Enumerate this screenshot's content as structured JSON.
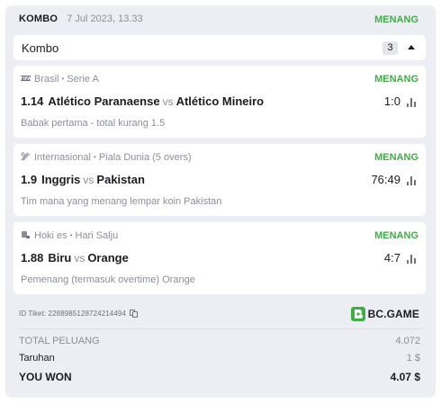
{
  "header": {
    "type": "KOMBO",
    "date": "7 Jul 2023, 13.33",
    "status": "MENANG"
  },
  "combo": {
    "label": "Kombo",
    "count": "3"
  },
  "bets": [
    {
      "league_icon": "football-icon",
      "region": "Brasil",
      "league": "Serie A",
      "status": "MENANG",
      "odds": "1.14",
      "team1": "Atlético Paranaense",
      "vs": "vs",
      "team2": "Atlético Mineiro",
      "score": "1:0",
      "market": "Babak pertama - total kurang 1.5"
    },
    {
      "league_icon": "cricket-icon",
      "region": "Internasional",
      "league": "Piala Dunia (5 overs)",
      "status": "MENANG",
      "odds": "1.9",
      "team1": "Inggris",
      "vs": "vs",
      "team2": "Pakistan",
      "score": "76:49",
      "market": "Tim mana yang menang lempar koin Pakistan"
    },
    {
      "league_icon": "hockey-icon",
      "region": "Hoki es",
      "league": "Hari Salju",
      "status": "MENANG",
      "odds": "1.88",
      "team1": "Biru",
      "vs": "vs",
      "team2": "Orange",
      "score": "4:7",
      "market": "Pemenang (termasuk overtime) Orange"
    }
  ],
  "ticket": {
    "id_label": "ID Tiket: 2288985128724214494"
  },
  "brand": {
    "name": "BC.GAME",
    "color": "#3cb043"
  },
  "summary": {
    "total_odds_label": "TOTAL PELUANG",
    "total_odds": "4.072",
    "stake_label": "Taruhan",
    "stake": "1 $",
    "won_label": "YOU WON",
    "won": "4.07 $"
  },
  "colors": {
    "win": "#3cb043",
    "muted": "#8b8f99",
    "panel": "#eceef3"
  }
}
